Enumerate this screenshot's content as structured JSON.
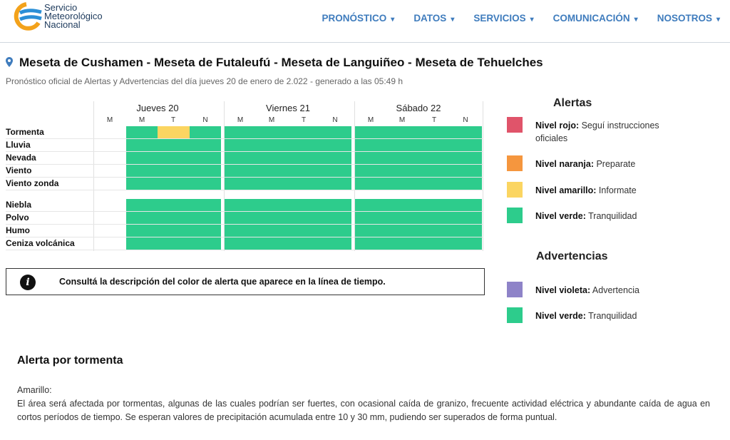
{
  "header": {
    "logo_lines": [
      "Servicio",
      "Meteorológico",
      "Nacional"
    ],
    "nav": [
      {
        "label": "PRONÓSTICO"
      },
      {
        "label": "DATOS"
      },
      {
        "label": "SERVICIOS"
      },
      {
        "label": "COMUNICACIÓN"
      },
      {
        "label": "NOSOTROS"
      }
    ],
    "caret": "▾"
  },
  "page": {
    "title": "Meseta de Cushamen - Meseta de Futaleufú - Meseta de Languiñeo - Meseta de Tehuelches",
    "subtitle": "Pronóstico oficial de Alertas y Advertencias del día jueves 20 de enero de 2.022 - generado a las 05:49 h"
  },
  "timeline": {
    "days": [
      {
        "label": "Jueves 20",
        "periods": [
          "M",
          "M",
          "T",
          "N"
        ]
      },
      {
        "label": "Viernes 21",
        "periods": [
          "M",
          "M",
          "T",
          "N"
        ]
      },
      {
        "label": "Sábado 22",
        "periods": [
          "M",
          "M",
          "T",
          "N"
        ]
      }
    ],
    "rows": [
      {
        "label": "Tormenta",
        "levels": [
          "none",
          "green",
          "yellow",
          "green",
          "green",
          "green",
          "green",
          "green",
          "green",
          "green",
          "green",
          "green"
        ]
      },
      {
        "label": "Lluvia",
        "levels": [
          "none",
          "green",
          "green",
          "green",
          "green",
          "green",
          "green",
          "green",
          "green",
          "green",
          "green",
          "green"
        ]
      },
      {
        "label": "Nevada",
        "levels": [
          "none",
          "green",
          "green",
          "green",
          "green",
          "green",
          "green",
          "green",
          "green",
          "green",
          "green",
          "green"
        ]
      },
      {
        "label": "Viento",
        "levels": [
          "none",
          "green",
          "green",
          "green",
          "green",
          "green",
          "green",
          "green",
          "green",
          "green",
          "green",
          "green"
        ]
      },
      {
        "label": "Viento zonda",
        "levels": [
          "none",
          "green",
          "green",
          "green",
          "green",
          "green",
          "green",
          "green",
          "green",
          "green",
          "green",
          "green"
        ]
      },
      {
        "label": "Niebla",
        "levels": [
          "none",
          "green",
          "green",
          "green",
          "green",
          "green",
          "green",
          "green",
          "green",
          "green",
          "green",
          "green"
        ]
      },
      {
        "label": "Polvo",
        "levels": [
          "none",
          "green",
          "green",
          "green",
          "green",
          "green",
          "green",
          "green",
          "green",
          "green",
          "green",
          "green"
        ]
      },
      {
        "label": "Humo",
        "levels": [
          "none",
          "green",
          "green",
          "green",
          "green",
          "green",
          "green",
          "green",
          "green",
          "green",
          "green",
          "green"
        ]
      },
      {
        "label": "Ceniza volcánica",
        "levels": [
          "none",
          "green",
          "green",
          "green",
          "green",
          "green",
          "green",
          "green",
          "green",
          "green",
          "green",
          "green"
        ]
      }
    ]
  },
  "info": {
    "icon": "i",
    "text": "Consultá la descripción del color de alerta que aparece en la línea de tiempo."
  },
  "legend": {
    "alerts_title": "Alertas",
    "alerts": [
      {
        "name": "Nivel rojo:",
        "desc": "Seguí instrucciones oficiales",
        "color": "#e0546a"
      },
      {
        "name": "Nivel naranja:",
        "desc": "Preparate",
        "color": "#f5963e"
      },
      {
        "name": "Nivel amarillo:",
        "desc": "Informate",
        "color": "#fbd561"
      },
      {
        "name": "Nivel verde:",
        "desc": "Tranquilidad",
        "color": "#2dcc8c"
      }
    ],
    "warnings_title": "Advertencias",
    "warnings": [
      {
        "name": "Nivel violeta:",
        "desc": "Advertencia",
        "color": "#8e83c8"
      },
      {
        "name": "Nivel verde:",
        "desc": "Tranquilidad",
        "color": "#2dcc8c"
      }
    ]
  },
  "alert_detail": {
    "title": "Alerta por tormenta",
    "level": "Amarillo:",
    "description": "El área será afectada por tormentas, algunas de las cuales podrían ser fuertes, con ocasional caída de granizo, frecuente actividad eléctrica y abundante caída de agua en cortos períodos de tiempo. Se esperan valores de precipitación acumulada entre 10 y 30 mm, pudiendo ser superados de forma puntual."
  }
}
